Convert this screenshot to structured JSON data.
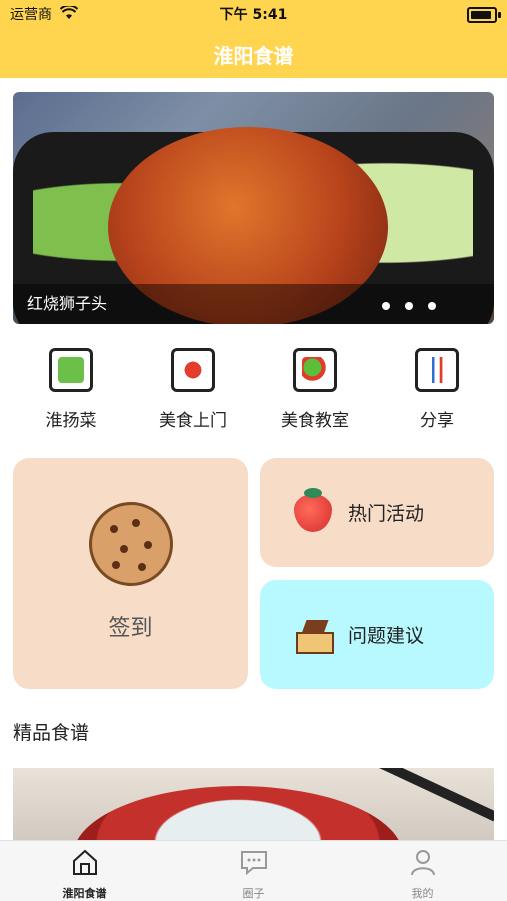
{
  "status_bar": {
    "carrier": "运营商",
    "time": "下午 5:41"
  },
  "nav": {
    "title": "淮阳食谱"
  },
  "banner": {
    "caption": "红烧狮子头",
    "page_count": 3,
    "active_page": 0
  },
  "quick_menu": [
    {
      "label": "淮扬菜",
      "icon": "list-icon"
    },
    {
      "label": "美食上门",
      "icon": "food-plate-icon"
    },
    {
      "label": "美食教室",
      "icon": "salad-icon"
    },
    {
      "label": "分享",
      "icon": "utensils-icon"
    }
  ],
  "cards": {
    "sign_in": {
      "label": "签到",
      "icon": "cookie-icon"
    },
    "hot_events": {
      "label": "热门活动",
      "icon": "strawberry-icon"
    },
    "feedback": {
      "label": "问题建议",
      "icon": "cake-icon"
    }
  },
  "section": {
    "title": "精品食谱"
  },
  "tabbar": {
    "items": [
      {
        "label": "淮阳食谱",
        "icon": "home-icon",
        "active": true
      },
      {
        "label": "圈子",
        "icon": "chat-icon",
        "active": false
      },
      {
        "label": "我的",
        "icon": "user-icon",
        "active": false
      }
    ]
  },
  "colors": {
    "accent": "#ffd54f",
    "card_peach": "#f7ddc8",
    "card_cyan": "#b8f9ff"
  }
}
